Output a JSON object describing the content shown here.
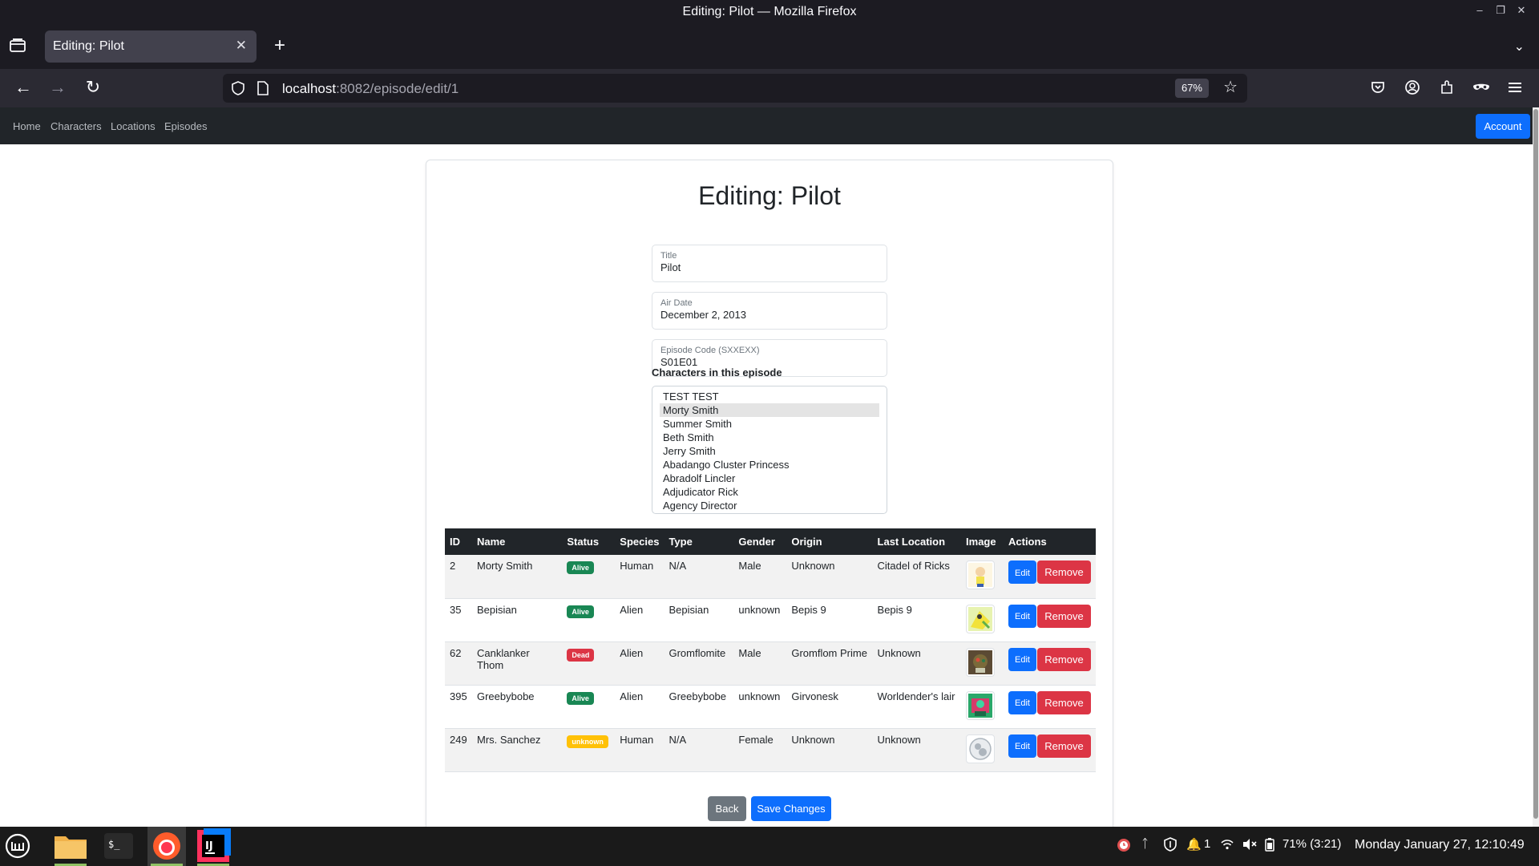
{
  "window": {
    "title": "Editing: Pilot — Mozilla Firefox"
  },
  "browser": {
    "tab_title": "Editing: Pilot",
    "url_host": "localhost",
    "url_rest": ":8082/episode/edit/1",
    "zoom": "67%"
  },
  "nav": {
    "links": [
      "Home",
      "Characters",
      "Locations",
      "Episodes"
    ],
    "account_label": "Account"
  },
  "page": {
    "heading": "Editing: Pilot",
    "fields": {
      "title_label": "Title",
      "title_value": "Pilot",
      "air_date_label": "Air Date",
      "air_date_value": "December 2, 2013",
      "code_label": "Episode Code (SXXEXX)",
      "code_value": "S01E01"
    },
    "characters_label": "Characters in this episode",
    "character_options": [
      "TEST TEST",
      "Morty Smith",
      "Summer Smith",
      "Beth Smith",
      "Jerry Smith",
      "Abadango Cluster Princess",
      "Abradolf Lincler",
      "Adjudicator Rick",
      "Agency Director"
    ],
    "selected_option": "Morty Smith",
    "table": {
      "headers": [
        "ID",
        "Name",
        "Status",
        "Species",
        "Type",
        "Gender",
        "Origin",
        "Last Location",
        "Image",
        "Actions"
      ],
      "rows": [
        {
          "id": "2",
          "name": "Morty Smith",
          "status": "Alive",
          "species": "Human",
          "type": "N/A",
          "gender": "Male",
          "origin": "Unknown",
          "location": "Citadel of Ricks"
        },
        {
          "id": "35",
          "name": "Bepisian",
          "status": "Alive",
          "species": "Alien",
          "type": "Bepisian",
          "gender": "unknown",
          "origin": "Bepis 9",
          "location": "Bepis 9"
        },
        {
          "id": "62",
          "name": "Canklanker Thom",
          "status": "Dead",
          "species": "Alien",
          "type": "Gromflomite",
          "gender": "Male",
          "origin": "Gromflom Prime",
          "location": "Unknown"
        },
        {
          "id": "395",
          "name": "Greebybobe",
          "status": "Alive",
          "species": "Alien",
          "type": "Greebybobe",
          "gender": "unknown",
          "origin": "Girvonesk",
          "location": "Worldender's lair"
        },
        {
          "id": "249",
          "name": "Mrs. Sanchez",
          "status": "unknown",
          "species": "Human",
          "type": "N/A",
          "gender": "Female",
          "origin": "Unknown",
          "location": "Unknown"
        }
      ],
      "edit_label": "Edit",
      "remove_label": "Remove"
    },
    "back_label": "Back",
    "save_label": "Save Changes"
  },
  "colors": {
    "alive": "#198754",
    "dead": "#dc3545",
    "unknown": "#ffc107",
    "primary": "#0d6efd",
    "navbar": "#212529"
  },
  "taskbar": {
    "tray_badge": "1",
    "battery": "71% (3:21)",
    "clock": "Monday January 27, 12:10:49"
  }
}
